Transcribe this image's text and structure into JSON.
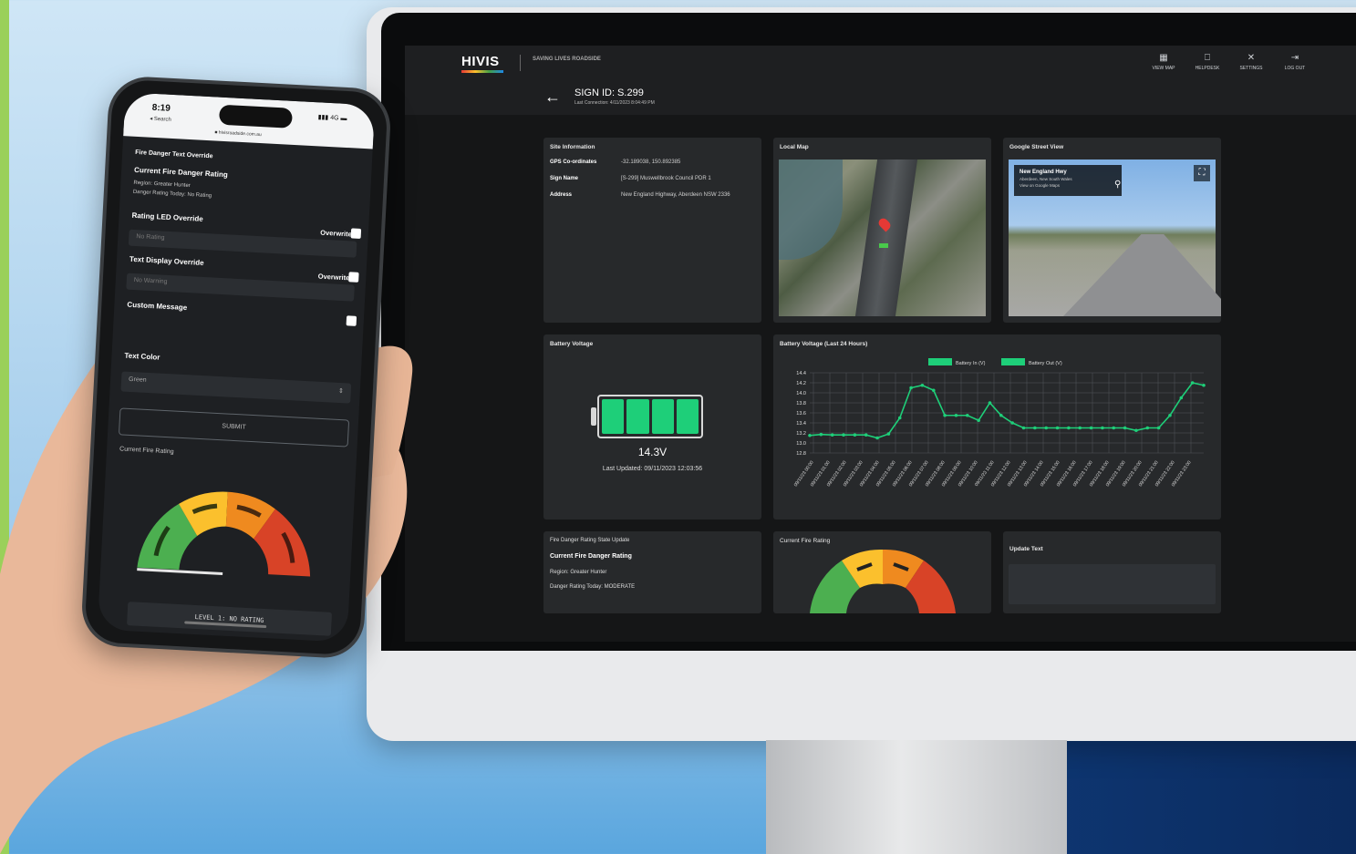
{
  "app": {
    "logo": "HIVIS",
    "partner": "SAVING LIVES ROADSIDE"
  },
  "nav": [
    {
      "icon": "▦",
      "label": "VIEW MAP"
    },
    {
      "icon": "⎕",
      "label": "HELPDESK"
    },
    {
      "icon": "✕",
      "label": "SETTINGS"
    },
    {
      "icon": "⇥",
      "label": "LOG OUT"
    }
  ],
  "header": {
    "back": "←",
    "sign_id": "SIGN ID: S.299",
    "last_connection": "Last Connection: 4/11/2023 8:04:49 PM"
  },
  "site_info": {
    "title": "Site Information",
    "rows": [
      {
        "k": "GPS Co-ordinates",
        "v": "-32.189038, 150.892385"
      },
      {
        "k": "Sign Name",
        "v": "[S-299] Muswellbrook Council PDR 1"
      },
      {
        "k": "Address",
        "v": "New England Highway, Aberdeen NSW 2336"
      }
    ]
  },
  "local_map": {
    "title": "Local Map"
  },
  "street_view": {
    "title": "Google Street View",
    "place": "New England Hwy",
    "sub1": "Aberdeen, New South Wales",
    "sub2": "View on Google Maps",
    "fullscreen": "⛶"
  },
  "battery": {
    "title": "Battery Voltage",
    "value": "14.3V",
    "updated": "Last Updated: 09/11/2023 12:03:56",
    "cells": 4
  },
  "chart_card_title": "Battery Voltage (Last 24 Hours)",
  "chart_data": {
    "type": "line",
    "title": "Battery Voltage (Last 24 Hours)",
    "legend": [
      "Battery In (V)",
      "Battery Out (V)"
    ],
    "legend_position": "top-center",
    "ylim": [
      13.0,
      14.4
    ],
    "yticks": [
      "14.4",
      "14.2",
      "14.0",
      "13.8",
      "13.6",
      "13.4",
      "13.2",
      "13.0",
      "12.8"
    ],
    "grid": true,
    "series": [
      {
        "name": "Battery In (V)",
        "color": "#1ecf79",
        "values": [
          13.15,
          13.17,
          13.16,
          13.16,
          13.16,
          13.16,
          13.1,
          13.18,
          13.5,
          14.1,
          14.15,
          14.05,
          13.55,
          13.55,
          13.55,
          13.45,
          13.8,
          13.55,
          13.4,
          13.3,
          13.3,
          13.3,
          13.3,
          13.3,
          13.3,
          13.3,
          13.3,
          13.3,
          13.3,
          13.25,
          13.3,
          13.3,
          13.55,
          13.9,
          14.2,
          14.15
        ]
      }
    ],
    "categories": [
      "09/11/23 00:00",
      "09/11/23 01:00",
      "09/11/23 02:00",
      "09/11/23 03:00",
      "09/11/23 04:00",
      "09/11/23 05:00",
      "09/11/23 06:00",
      "09/11/23 07:00",
      "09/11/23 08:00",
      "09/11/23 09:00",
      "09/11/23 10:00",
      "09/11/23 11:00",
      "09/11/23 12:00",
      "09/11/23 13:00",
      "09/11/23 14:00",
      "09/11/23 15:00",
      "09/11/23 16:00",
      "09/11/23 17:00",
      "09/11/23 18:00",
      "09/11/23 19:00",
      "09/11/23 20:00",
      "09/11/23 21:00",
      "09/11/23 22:00",
      "09/11/23 23:00"
    ]
  },
  "fire_state": {
    "title": "Fire Danger Rating State Update",
    "heading": "Current Fire Danger Rating",
    "region": "Region: Greater Hunter",
    "today": "Danger Rating Today: MODERATE"
  },
  "current_fire": {
    "title": "Current Fire Rating"
  },
  "update_text": {
    "title": "Update Text"
  },
  "phone": {
    "time": "8:19",
    "back": "◂ Search",
    "url": "■ hivisroadside.com.au",
    "signal": "▮▮▮ 4G ▬",
    "fire_text_override": "Fire Danger Text Override",
    "current_rating_label": "Current Fire Danger Rating",
    "region": "Region: Greater Hunter",
    "danger_today": "Danger Rating Today: No Rating",
    "rating_led": "Rating LED Override",
    "rating_led_placeholder": "No Rating",
    "overwrite": "Overwrite",
    "text_display": "Text Display Override",
    "text_display_placeholder": "No Warning",
    "custom_message": "Custom Message",
    "text_color": "Text Color",
    "text_color_value": "Green",
    "submit": "SUBMIT",
    "current_fire": "Current Fire Rating",
    "level_button": "LEVEL 1: NO RATING"
  }
}
